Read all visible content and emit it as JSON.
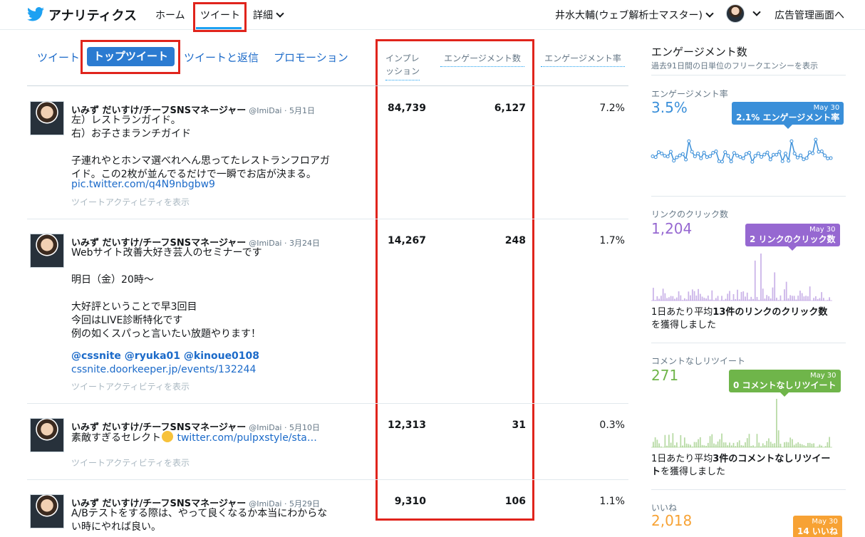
{
  "nav": {
    "brand": "アナリティクス",
    "home": "ホーム",
    "tweets": "ツイート",
    "more": "詳細",
    "user": "井水大輔(ウェブ解析士マスター)",
    "ads": "広告管理画面へ"
  },
  "subtabs": {
    "tweets": "ツイート",
    "top": "トップツイート",
    "replies": "ツイートと返信",
    "promotions": "プロモーション"
  },
  "columns": {
    "impressions_line1": "インプレ",
    "impressions_line2": "ッション",
    "engagements": "エンゲージメント数",
    "rate": "エンゲージメント率"
  },
  "tweets": [
    {
      "name": "いみず だいすけ/チーフSNSマネージャー",
      "handle": "@ImiDai · 5月1日",
      "text": "左）レストランガイド。\n右）お子さまランチガイド\n\n子連れやとホンマ選べれへん思ってたレストランフロアガ\nイド。この2枚が並んでるだけで一瞬でお店が決まる。",
      "link": "pic.twitter.com/q4N9nbgbw9",
      "activity": "ツイートアクティビティを表示",
      "impressions": "84,739",
      "engagements": "6,127",
      "rate": "7.2%"
    },
    {
      "name": "いみず だいすけ/チーフSNSマネージャー",
      "handle": "@ImiDai · 3月24日",
      "text": "Webサイト改善大好き芸人のセミナーです\n\n明日（金）20時〜\n\n大好評ということで早3回目\n今回はLIVE診断特化です\n例の如くスパっと言いたい放題やります！",
      "mentions": "@cssnite @ryuka01  @kinoue0108",
      "link": "cssnite.doorkeeper.jp/events/132244",
      "activity": "ツイートアクティビティを表示",
      "impressions": "14,267",
      "engagements": "248",
      "rate": "1.7%"
    },
    {
      "name": "いみず だいすけ/チーフSNSマネージャー",
      "handle": "@ImiDai · 5月10日",
      "text": "素敵すぎるセレクト",
      "link": "twitter.com/pulpxstyle/sta…",
      "activity": "ツイートアクティビティを表示",
      "impressions": "12,313",
      "engagements": "31",
      "rate": "0.3%"
    },
    {
      "name": "いみず だいすけ/チーフSNSマネージャー",
      "handle": "@ImiDai · 5月29日",
      "text": "A/Bテストをする際は、やって良くなるか本当にわからな\nい時にやれば良い。",
      "impressions": "9,310",
      "engagements": "106",
      "rate": "1.1%"
    }
  ],
  "panel": {
    "title": "エンゲージメント数",
    "subtitle": "過去91日間の日単位のフリークエンシーを表示",
    "colors": {
      "blue": "#3a8fd9",
      "purple": "#9668d1",
      "green": "#6fb54a",
      "orange": "#f7a234"
    },
    "engagement_rate": {
      "label": "エンゲージメント率",
      "value": "3.5%",
      "tip_date": "May 30",
      "tip_text": "2.1% エンゲージメント率"
    },
    "link_clicks": {
      "label": "リンクのクリック数",
      "value": "1,204",
      "tip_date": "May 30",
      "tip_text": "2 リンクのクリック数",
      "avg_pre": "1日あたり平均",
      "avg_bold": "13件のリンクのクリック数",
      "avg_post": "を獲得しました"
    },
    "retweets": {
      "label": "コメントなしリツイート",
      "value": "271",
      "tip_date": "May 30",
      "tip_text": "0 コメントなしリツイート",
      "avg_pre": "1日あたり平均",
      "avg_bold": "3件のコメントなしリツイート",
      "avg_post": "を獲得しました"
    },
    "likes": {
      "label": "いいね",
      "value": "2,018",
      "tip_date": "May 30",
      "tip_text": "14 いいね"
    }
  }
}
